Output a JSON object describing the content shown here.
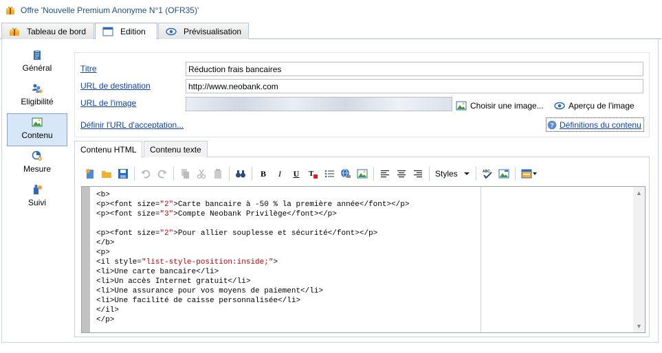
{
  "window": {
    "title": "Offre 'Nouvelle Premium Anonyme N°1 (OFR35)'"
  },
  "tabs": [
    {
      "label": "Tableau de bord",
      "icon": "dashboard-icon"
    },
    {
      "label": "Edition",
      "icon": "edit-window-icon",
      "active": true
    },
    {
      "label": "Prévisualisation",
      "icon": "eye-icon"
    }
  ],
  "sidebar": {
    "items": [
      {
        "label": "Général",
        "icon": "clipboard-icon"
      },
      {
        "label": "Eligibilité",
        "icon": "users-icon"
      },
      {
        "label": "Contenu",
        "icon": "content-icon",
        "active": true
      },
      {
        "label": "Mesure",
        "icon": "measure-icon"
      },
      {
        "label": "Suivi",
        "icon": "tracking-icon"
      }
    ]
  },
  "form": {
    "title_label": "Titre",
    "title_value": "Réduction frais bancaires",
    "dest_url_label": "URL de destination",
    "dest_url_value": "http://www.neobank.com",
    "image_url_label": "URL de l'image",
    "choose_image": "Choisir une image...",
    "preview_image": "Aperçu de l'image",
    "accept_url_link": "Définir l'URL d'acceptation...",
    "definitions_link": "Définitions du contenu"
  },
  "content_tabs": [
    {
      "label": "Contenu HTML",
      "active": true
    },
    {
      "label": "Contenu texte"
    }
  ],
  "toolbar": {
    "styles_label": "Styles",
    "bold": "B",
    "italic": "I",
    "underline": "U"
  },
  "code_lines": [
    "<b>",
    "<p><font size=\"2\">Carte bancaire à -50 % la première année</font></p>",
    "<p><font size=\"3\">Compte Neobank Privilège</font></p>",
    "",
    "<p><font size=\"2\">Pour allier souplesse et sécurité</font></p>",
    "</b>",
    "<p>",
    "<il style=\"list-style-position:inside;\">",
    "<li>Une carte bancaire</li>",
    "<li>Un accès Internet gratuit</li>",
    "<li>Une assurance pour vos moyens de paiement</li>",
    "<li>Une facilité de caisse personnalisée</li>",
    "</il>",
    "</p>"
  ],
  "colors": {
    "link": "#0a3fb5",
    "string": "#c00000",
    "active_bg": "#d7e7f8"
  }
}
